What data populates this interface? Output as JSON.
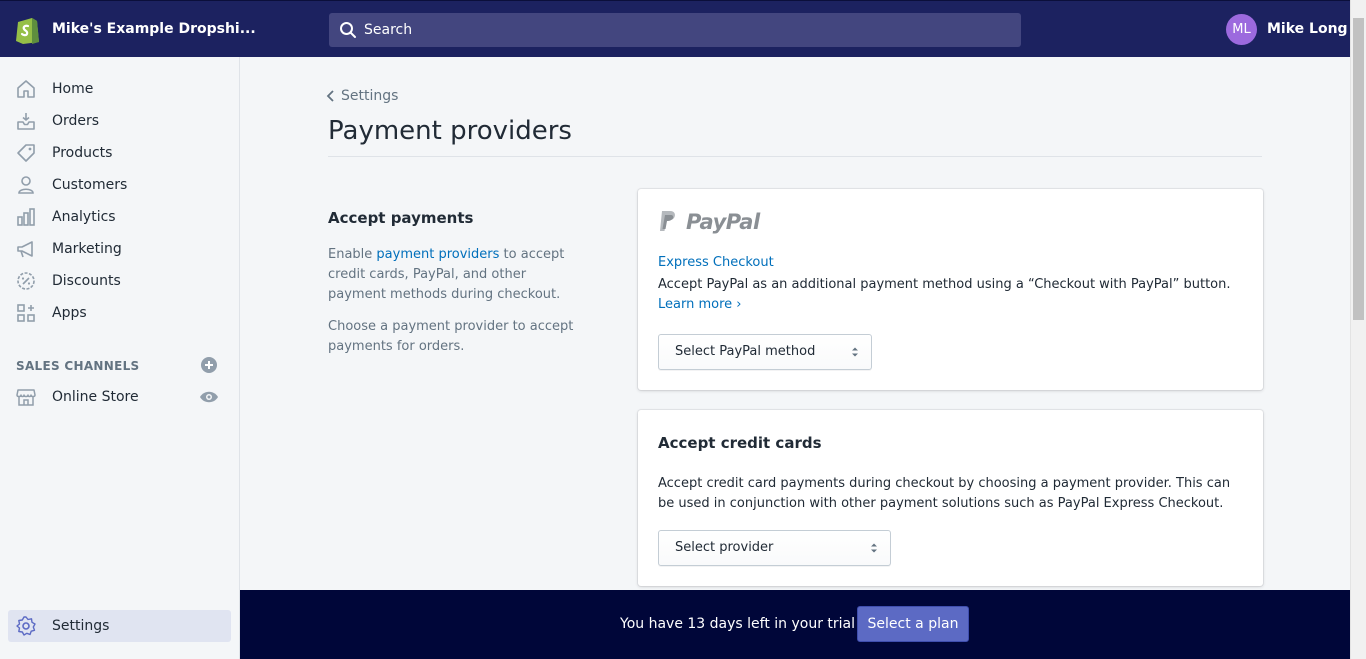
{
  "header": {
    "store_name": "Mike's Example Dropshi...",
    "search_placeholder": "Search",
    "user_initials": "ML",
    "user_name": "Mike Long"
  },
  "sidebar": {
    "items": [
      {
        "label": "Home",
        "icon": "home-icon"
      },
      {
        "label": "Orders",
        "icon": "orders-icon"
      },
      {
        "label": "Products",
        "icon": "tag-icon"
      },
      {
        "label": "Customers",
        "icon": "person-icon"
      },
      {
        "label": "Analytics",
        "icon": "bar-chart-icon"
      },
      {
        "label": "Marketing",
        "icon": "megaphone-icon"
      },
      {
        "label": "Discounts",
        "icon": "discount-icon"
      },
      {
        "label": "Apps",
        "icon": "apps-icon"
      }
    ],
    "sales_channels_heading": "SALES CHANNELS",
    "online_store_label": "Online Store",
    "settings_label": "Settings"
  },
  "main": {
    "breadcrumb": "Settings",
    "title": "Payment providers",
    "accept_payments": {
      "title": "Accept payments",
      "desc_prefix": "Enable ",
      "desc_link": "payment providers",
      "desc_suffix": " to accept credit cards, PayPal, and other payment methods during checkout.",
      "desc2": "Choose a payment provider to accept payments for orders."
    },
    "paypal_card": {
      "logo_text": "PayPal",
      "express_checkout_link": "Express Checkout",
      "desc": "Accept PayPal as an additional payment method using a “Checkout with PayPal” button. ",
      "learn_more": "Learn more ›",
      "select_label": "Select PayPal method"
    },
    "credit_card": {
      "title": "Accept credit cards",
      "desc": "Accept credit card payments during checkout by choosing a payment provider. This can be used in conjunction with other payment solutions such as PayPal Express Checkout.",
      "select_label": "Select provider"
    }
  },
  "trial": {
    "text": "You have 13 days left in your trial",
    "button_label": "Select a plan"
  },
  "colors": {
    "topbar": "#1c2260",
    "trialbar": "#000639",
    "accent": "#5c6ac4",
    "link": "#006fbb",
    "avatar": "#9c6ade"
  }
}
